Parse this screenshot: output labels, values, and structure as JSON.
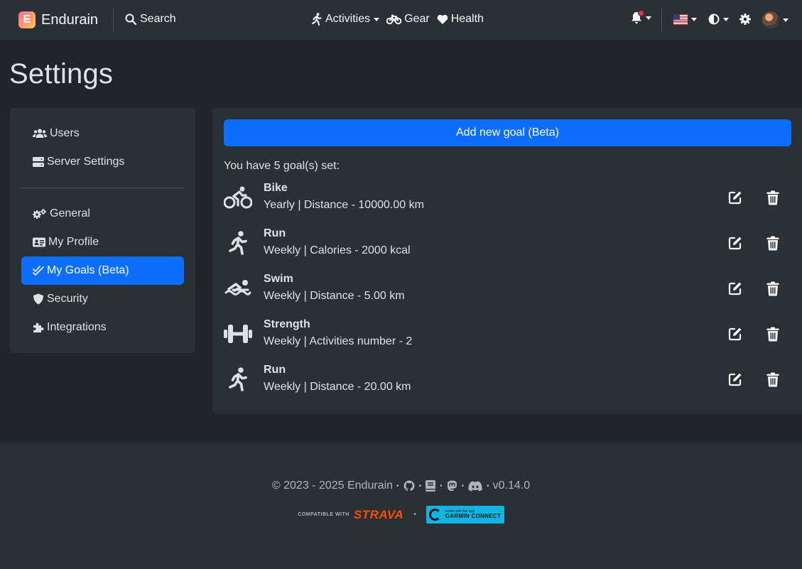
{
  "navbar": {
    "brand": "Endurain",
    "brand_logo_letter": "E",
    "search_label": "Search",
    "activities_label": "Activities",
    "gear_label": "Gear",
    "health_label": "Health",
    "notification_color": "#dc3545"
  },
  "page": {
    "title": "Settings"
  },
  "sidebar": {
    "items": [
      {
        "label": "Users",
        "icon": "users-icon"
      },
      {
        "label": "Server Settings",
        "icon": "server-icon"
      },
      {
        "label": "General",
        "icon": "gears-icon"
      },
      {
        "label": "My Profile",
        "icon": "id-card-icon"
      },
      {
        "label": "My Goals (Beta)",
        "icon": "check-double-icon",
        "active": true
      },
      {
        "label": "Security",
        "icon": "shield-icon"
      },
      {
        "label": "Integrations",
        "icon": "puzzle-icon"
      }
    ]
  },
  "goals": {
    "add_button_label": "Add new goal (Beta)",
    "count_text": "You have 5 goal(s) set:",
    "items": [
      {
        "title": "Bike",
        "description": "Yearly | Distance - 10000.00 km",
        "icon": "bike-icon"
      },
      {
        "title": "Run",
        "description": "Weekly | Calories - 2000 kcal",
        "icon": "run-icon"
      },
      {
        "title": "Swim",
        "description": "Weekly | Distance - 5.00 km",
        "icon": "swim-icon"
      },
      {
        "title": "Strength",
        "description": "Weekly | Activities number - 2",
        "icon": "dumbbell-icon"
      },
      {
        "title": "Run",
        "description": "Weekly | Distance - 20.00 km",
        "icon": "run-icon"
      }
    ]
  },
  "footer": {
    "copyright": "© 2023 - 2025 Endurain",
    "version": "v0.14.0",
    "strava_small": "COMPATIBLE WITH",
    "strava_word": "STRAVA",
    "garmin_small": "works with the app",
    "garmin_big": "GARMIN CONNECT"
  },
  "colors": {
    "accent": "#0d6efd",
    "background": "#212529",
    "surface": "#2b3035",
    "strava": "#fc4c02",
    "garmin": "#11b5e4"
  }
}
